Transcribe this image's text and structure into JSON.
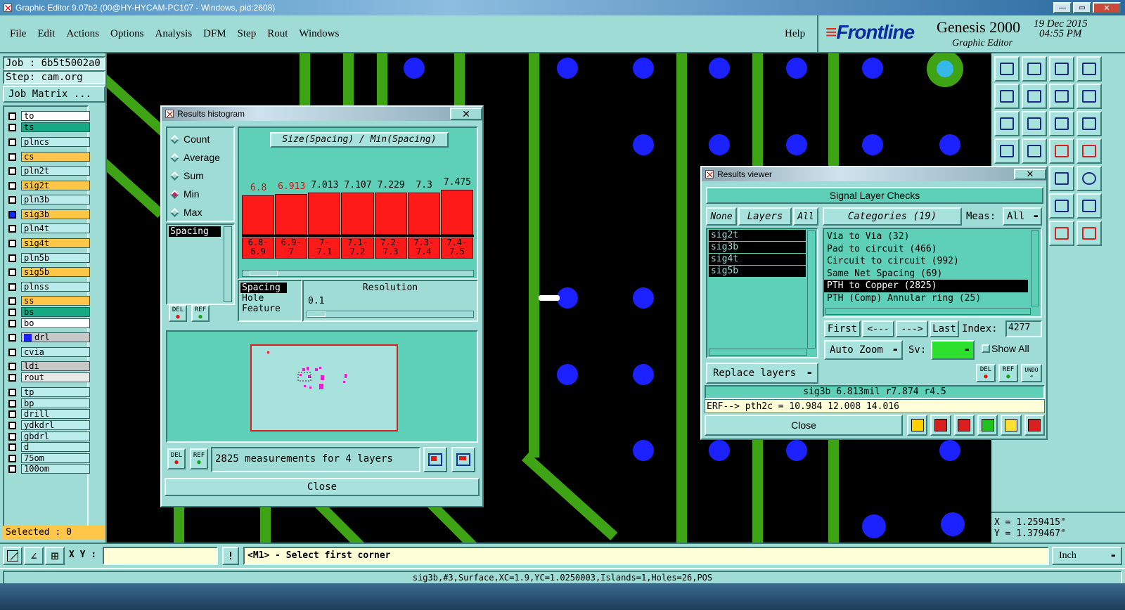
{
  "titlebar": {
    "title": "Graphic Editor 9.07b2 (00@HY-HYCAM-PC107 - Windows, pid:2608)"
  },
  "menu": {
    "items": [
      "File",
      "Edit",
      "Actions",
      "Options",
      "Analysis",
      "DFM",
      "Step",
      "Rout",
      "Windows"
    ],
    "help": "Help"
  },
  "brand": {
    "logo": "Frontline",
    "product": "Genesis 2000",
    "subtitle": "Graphic Editor",
    "date": "19 Dec 2015",
    "time": "04:55 PM"
  },
  "job": {
    "job_label": "Job : 6b5t5002a0",
    "step_label": "Step: cam.org",
    "matrix_button": "Job Matrix ..."
  },
  "layers": [
    {
      "name": "to",
      "color": "#ffffff"
    },
    {
      "name": "ts",
      "color": "#17a884"
    },
    {
      "name": "plncs",
      "color": "#b9ecea"
    },
    {
      "name": "cs",
      "color": "#ffc64a"
    },
    {
      "name": "pln2t",
      "color": "#b9ecea"
    },
    {
      "name": "sig2t",
      "color": "#ffc64a"
    },
    {
      "name": "pln3b",
      "color": "#b9ecea"
    },
    {
      "name": "sig3b",
      "color": "#ffc64a"
    },
    {
      "name": "pln4t",
      "color": "#b9ecea"
    },
    {
      "name": "sig4t",
      "color": "#ffc64a"
    },
    {
      "name": "pln5b",
      "color": "#b9ecea"
    },
    {
      "name": "sig5b",
      "color": "#ffc64a"
    },
    {
      "name": "plnss",
      "color": "#b9ecea"
    },
    {
      "name": "ss",
      "color": "#ffc64a"
    },
    {
      "name": "bs",
      "color": "#17a884"
    },
    {
      "name": "bo",
      "color": "#ffffff"
    },
    {
      "name": "drl",
      "color": "#c8c8c8"
    },
    {
      "name": "cvia",
      "color": "#b9ecea"
    },
    {
      "name": "ldi",
      "color": "#c8c8c8"
    },
    {
      "name": "rout",
      "color": "#e8e8e8"
    },
    {
      "name": "tp",
      "color": "#b9ecea"
    },
    {
      "name": "bp",
      "color": "#b9ecea"
    },
    {
      "name": "drill",
      "color": "#b9ecea"
    },
    {
      "name": "ydkdrl",
      "color": "#b9ecea"
    },
    {
      "name": "gbdrl",
      "color": "#b9ecea"
    },
    {
      "name": "d",
      "color": "#b9ecea"
    },
    {
      "name": "75om",
      "color": "#b9ecea"
    },
    {
      "name": "100om",
      "color": "#b9ecea"
    }
  ],
  "selected": "Selected : 0",
  "histogram": {
    "title": "Results histogram",
    "modes": [
      "Count",
      "Average",
      "Sum",
      "Min",
      "Max"
    ],
    "active_mode": "Min",
    "measure_list": [
      "Spacing"
    ],
    "chart_title": "Size(Spacing) / Min(Spacing)",
    "bar_values": [
      "6.8",
      "6.913",
      "7.013",
      "7.107",
      "7.229",
      "7.3",
      "7.475"
    ],
    "bin_labels": [
      "6.8-\n6.9",
      "6.9-\n7",
      "7-\n7.1",
      "7.1-\n7.2",
      "7.2-\n7.3",
      "7.3-\n7.4",
      "7.4-\n7.5"
    ],
    "types": [
      "Spacing",
      "Hole",
      "Feature"
    ],
    "resolution_label": "Resolution",
    "resolution_value": "0.1",
    "del": "DEL",
    "ref": "REF",
    "summary": "2825 measurements for 4 layers",
    "close": "Close"
  },
  "viewer": {
    "title": "Results viewer",
    "header": "Signal Layer Checks",
    "none": "None",
    "layers_label": "Layers",
    "all": "All",
    "categories_label": "Categories (19)",
    "meas_label": "Meas:",
    "meas_value": "All",
    "layer_list": [
      "sig2t",
      "sig3b",
      "sig4t",
      "sig5b"
    ],
    "categories": [
      "Via to Via (32)",
      "Pad to circuit (466)",
      "Circuit to circuit (992)",
      "Same Net Spacing (69)",
      "PTH to Copper (2825)",
      "PTH (Comp) Annular ring (25)"
    ],
    "selected_category": "PTH to Copper (2825)",
    "first": "First",
    "prev": "<---",
    "next": "--->",
    "last": "Last",
    "index_label": "Index:",
    "index_value": "4277",
    "auto_zoom": "Auto Zoom",
    "sv_label": "Sv:",
    "show_all": "Show All",
    "replace_layers": "Replace layers",
    "del": "DEL",
    "ref": "REF",
    "undo": "UNDO",
    "info": "sig3b 6.813mil  r7.874  r4.5",
    "erf": "ERF--> pth2c = 10.984 12.008 14.016",
    "close": "Close"
  },
  "coords": {
    "x": "X = 1.259415\"",
    "y": "Y = 1.379467\""
  },
  "bottom": {
    "xy_label": "X Y :",
    "xy_value": "",
    "prompt": "<M1> - Select first corner",
    "units": "Inch"
  },
  "statusbar": "sig3b,#3,Surface,XC=1.9,YC=1.0250003,Islands=1,Holes=26,POS",
  "colors": {
    "panel": "#9fdcd6",
    "track": "#3fa316",
    "via": "#1b22ff",
    "bar": "#ff1a1a"
  }
}
